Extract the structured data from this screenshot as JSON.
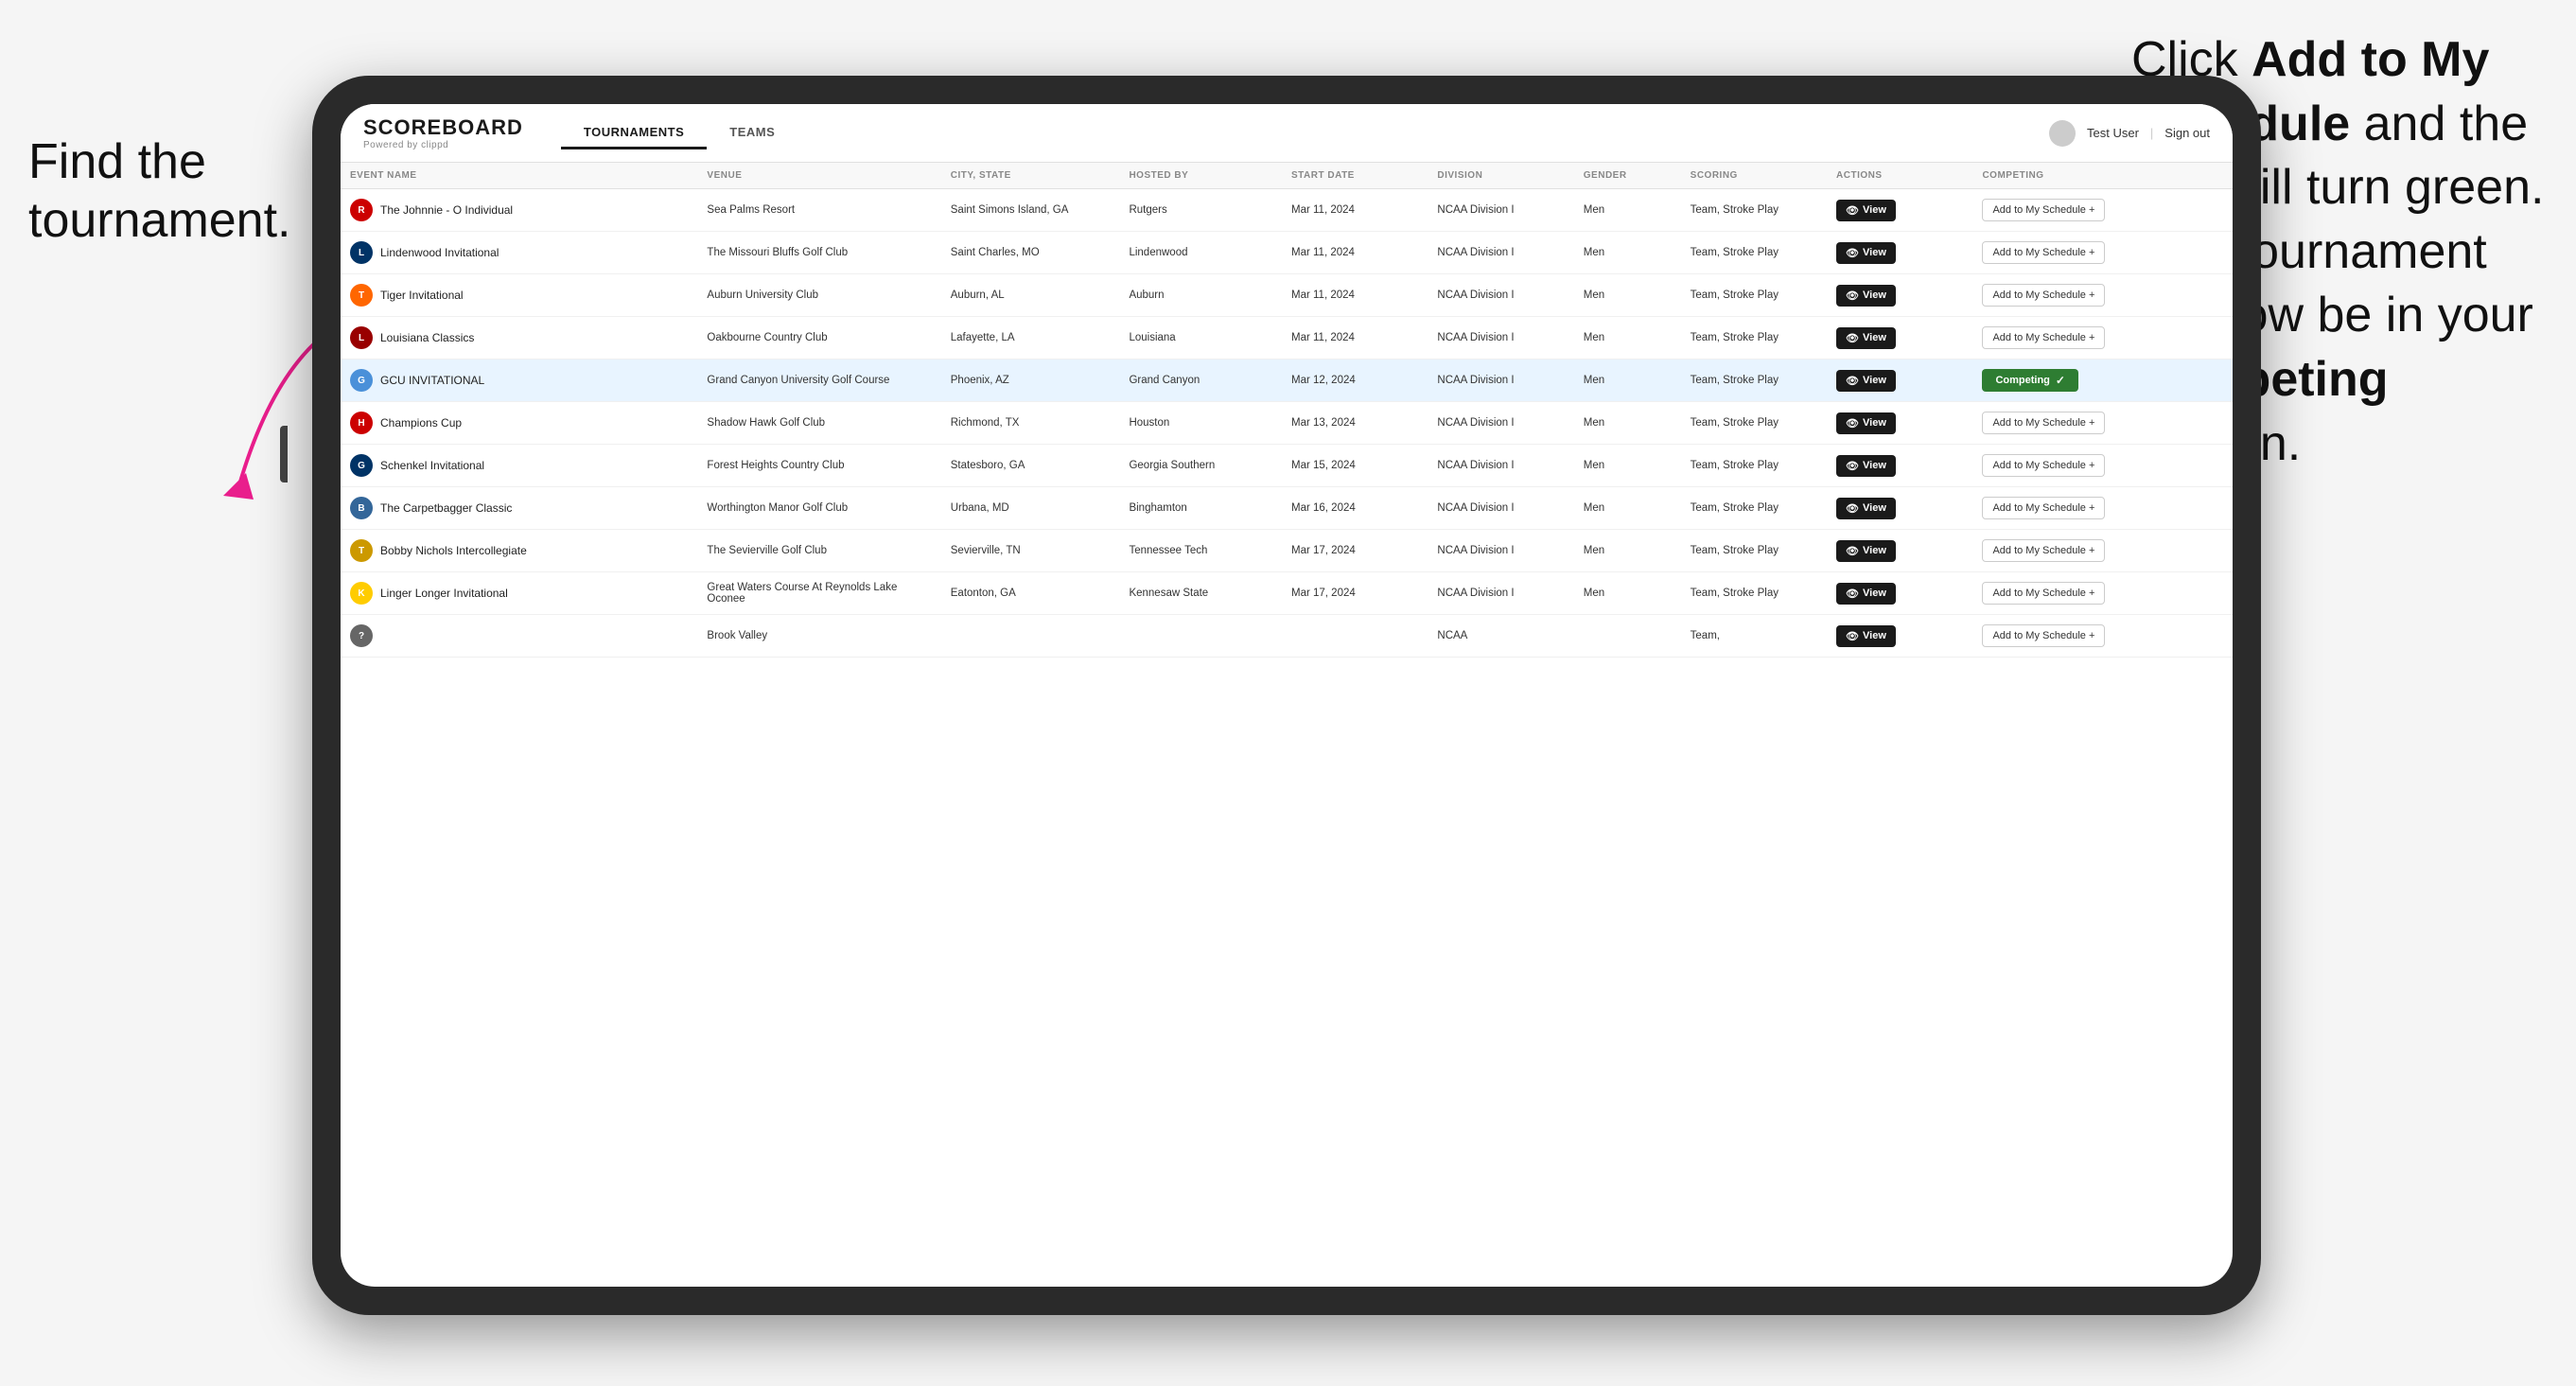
{
  "annotations": {
    "left": "Find the tournament.",
    "right_part1": "Click ",
    "right_bold1": "Add to My Schedule",
    "right_part2": " and the box will turn green. This tournament will now be in your ",
    "right_bold2": "Competing",
    "right_part3": " section."
  },
  "app": {
    "logo": "SCOREBOARD",
    "logo_sub": "Powered by clippd",
    "nav": [
      "TOURNAMENTS",
      "TEAMS"
    ],
    "active_nav": "TOURNAMENTS",
    "user": "Test User",
    "sign_out": "Sign out"
  },
  "table": {
    "columns": [
      "EVENT NAME",
      "VENUE",
      "CITY, STATE",
      "HOSTED BY",
      "START DATE",
      "DIVISION",
      "GENDER",
      "SCORING",
      "ACTIONS",
      "COMPETING"
    ],
    "rows": [
      {
        "id": 1,
        "logo_color": "#cc0000",
        "logo_letter": "R",
        "event": "The Johnnie - O Individual",
        "venue": "Sea Palms Resort",
        "city": "Saint Simons Island, GA",
        "hosted": "Rutgers",
        "date": "Mar 11, 2024",
        "division": "NCAA Division I",
        "gender": "Men",
        "scoring": "Team, Stroke Play",
        "status": "add",
        "highlighted": false
      },
      {
        "id": 2,
        "logo_color": "#003366",
        "logo_letter": "L",
        "event": "Lindenwood Invitational",
        "venue": "The Missouri Bluffs Golf Club",
        "city": "Saint Charles, MO",
        "hosted": "Lindenwood",
        "date": "Mar 11, 2024",
        "division": "NCAA Division I",
        "gender": "Men",
        "scoring": "Team, Stroke Play",
        "status": "add",
        "highlighted": false
      },
      {
        "id": 3,
        "logo_color": "#ff6600",
        "logo_letter": "T",
        "event": "Tiger Invitational",
        "venue": "Auburn University Club",
        "city": "Auburn, AL",
        "hosted": "Auburn",
        "date": "Mar 11, 2024",
        "division": "NCAA Division I",
        "gender": "Men",
        "scoring": "Team, Stroke Play",
        "status": "add",
        "highlighted": false
      },
      {
        "id": 4,
        "logo_color": "#990000",
        "logo_letter": "LA",
        "event": "Louisiana Classics",
        "venue": "Oakbourne Country Club",
        "city": "Lafayette, LA",
        "hosted": "Louisiana",
        "date": "Mar 11, 2024",
        "division": "NCAA Division I",
        "gender": "Men",
        "scoring": "Team, Stroke Play",
        "status": "add",
        "highlighted": false
      },
      {
        "id": 5,
        "logo_color": "#4a90d9",
        "logo_letter": "GCU",
        "event": "GCU INVITATIONAL",
        "venue": "Grand Canyon University Golf Course",
        "city": "Phoenix, AZ",
        "hosted": "Grand Canyon",
        "date": "Mar 12, 2024",
        "division": "NCAA Division I",
        "gender": "Men",
        "scoring": "Team, Stroke Play",
        "status": "competing",
        "highlighted": true
      },
      {
        "id": 6,
        "logo_color": "#cc0000",
        "logo_letter": "H",
        "event": "Champions Cup",
        "venue": "Shadow Hawk Golf Club",
        "city": "Richmond, TX",
        "hosted": "Houston",
        "date": "Mar 13, 2024",
        "division": "NCAA Division I",
        "gender": "Men",
        "scoring": "Team, Stroke Play",
        "status": "add",
        "highlighted": false
      },
      {
        "id": 7,
        "logo_color": "#003366",
        "logo_letter": "GS",
        "event": "Schenkel Invitational",
        "venue": "Forest Heights Country Club",
        "city": "Statesboro, GA",
        "hosted": "Georgia Southern",
        "date": "Mar 15, 2024",
        "division": "NCAA Division I",
        "gender": "Men",
        "scoring": "Team, Stroke Play",
        "status": "add",
        "highlighted": false
      },
      {
        "id": 8,
        "logo_color": "#336699",
        "logo_letter": "B",
        "event": "The Carpetbagger Classic",
        "venue": "Worthington Manor Golf Club",
        "city": "Urbana, MD",
        "hosted": "Binghamton",
        "date": "Mar 16, 2024",
        "division": "NCAA Division I",
        "gender": "Men",
        "scoring": "Team, Stroke Play",
        "status": "add",
        "highlighted": false
      },
      {
        "id": 9,
        "logo_color": "#cc9900",
        "logo_letter": "TT",
        "event": "Bobby Nichols Intercollegiate",
        "venue": "The Sevierville Golf Club",
        "city": "Sevierville, TN",
        "hosted": "Tennessee Tech",
        "date": "Mar 17, 2024",
        "division": "NCAA Division I",
        "gender": "Men",
        "scoring": "Team, Stroke Play",
        "status": "add",
        "highlighted": false
      },
      {
        "id": 10,
        "logo_color": "#ffcc00",
        "logo_letter": "K",
        "event": "Linger Longer Invitational",
        "venue": "Great Waters Course At Reynolds Lake Oconee",
        "city": "Eatonton, GA",
        "hosted": "Kennesaw State",
        "date": "Mar 17, 2024",
        "division": "NCAA Division I",
        "gender": "Men",
        "scoring": "Team, Stroke Play",
        "status": "add",
        "highlighted": false
      },
      {
        "id": 11,
        "logo_color": "#666666",
        "logo_letter": "?",
        "event": "",
        "venue": "Brook Valley",
        "city": "",
        "hosted": "",
        "date": "",
        "division": "NCAA",
        "gender": "",
        "scoring": "Team,",
        "status": "add",
        "highlighted": false
      }
    ],
    "view_label": "View",
    "add_label": "Add to My Schedule +",
    "competing_label": "Competing ✓"
  }
}
